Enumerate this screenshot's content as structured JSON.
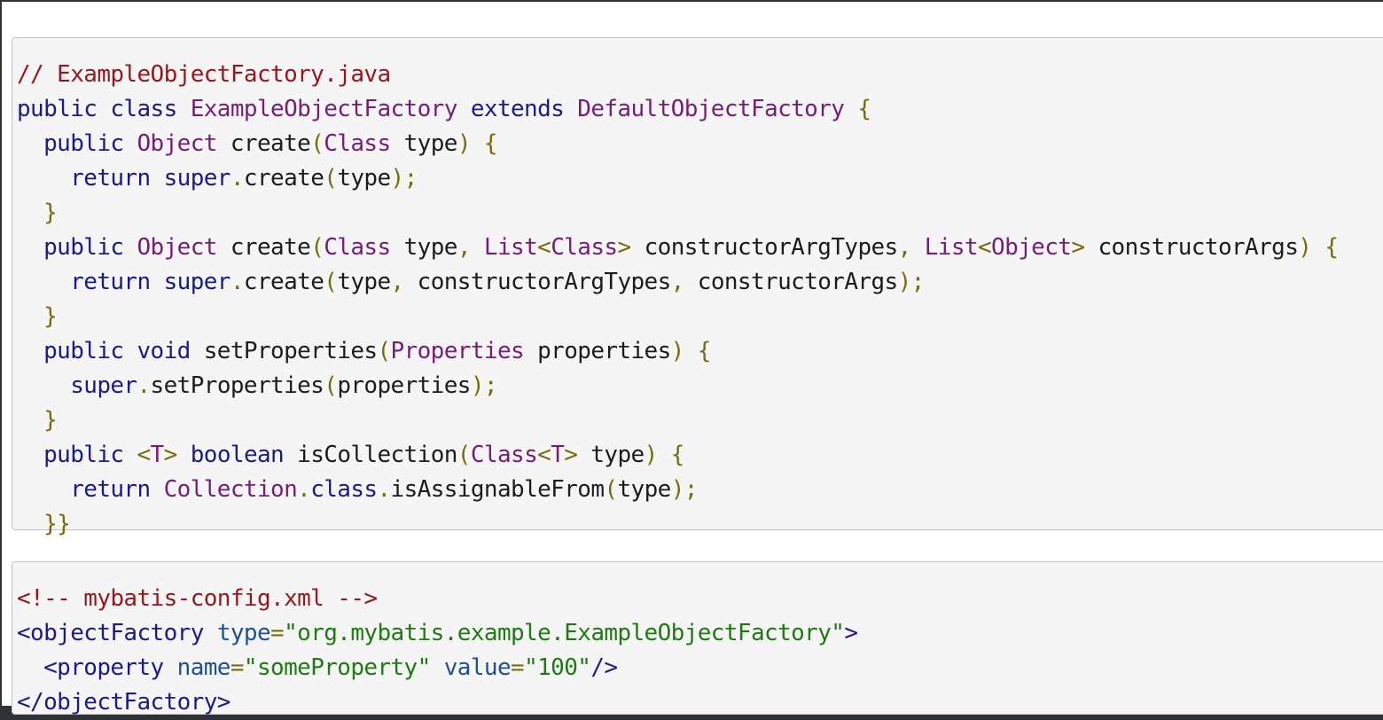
{
  "colors": {
    "comment": "#99171a",
    "keyword": "#1a1a8f",
    "type": "#771d79",
    "punct": "#7a6b0a",
    "plain": "#1c1c1c",
    "tag": "#1a1a8f",
    "attr": "#1f4f96",
    "string": "#1f7a12",
    "block_background": "#f5f5f5",
    "frame_background": "#2e3338"
  },
  "blocks": [
    {
      "language": "java",
      "lines": [
        [
          [
            "comment",
            "// ExampleObjectFactory.java"
          ]
        ],
        [
          [
            "keyword",
            "public class "
          ],
          [
            "type",
            "ExampleObjectFactory"
          ],
          [
            "keyword",
            " extends "
          ],
          [
            "type",
            "DefaultObjectFactory"
          ],
          [
            "punct",
            " {"
          ]
        ],
        [
          [
            "keyword",
            "  public "
          ],
          [
            "type",
            "Object"
          ],
          [
            "plain",
            " create"
          ],
          [
            "punct",
            "("
          ],
          [
            "type",
            "Class"
          ],
          [
            "plain",
            " type"
          ],
          [
            "punct",
            ") {"
          ]
        ],
        [
          [
            "keyword",
            "    return super"
          ],
          [
            "punct",
            "."
          ],
          [
            "plain",
            "create"
          ],
          [
            "punct",
            "("
          ],
          [
            "plain",
            "type"
          ],
          [
            "punct",
            ");"
          ]
        ],
        [
          [
            "punct",
            "  }"
          ]
        ],
        [
          [
            "keyword",
            "  public "
          ],
          [
            "type",
            "Object"
          ],
          [
            "plain",
            " create"
          ],
          [
            "punct",
            "("
          ],
          [
            "type",
            "Class"
          ],
          [
            "plain",
            " type"
          ],
          [
            "punct",
            ", "
          ],
          [
            "type",
            "List"
          ],
          [
            "punct",
            "<"
          ],
          [
            "type",
            "Class"
          ],
          [
            "punct",
            ">"
          ],
          [
            "plain",
            " constructorArgTypes"
          ],
          [
            "punct",
            ", "
          ],
          [
            "type",
            "List"
          ],
          [
            "punct",
            "<"
          ],
          [
            "type",
            "Object"
          ],
          [
            "punct",
            ">"
          ],
          [
            "plain",
            " constructorArgs"
          ],
          [
            "punct",
            ") {"
          ]
        ],
        [
          [
            "keyword",
            "    return super"
          ],
          [
            "punct",
            "."
          ],
          [
            "plain",
            "create"
          ],
          [
            "punct",
            "("
          ],
          [
            "plain",
            "type"
          ],
          [
            "punct",
            ", "
          ],
          [
            "plain",
            "constructorArgTypes"
          ],
          [
            "punct",
            ", "
          ],
          [
            "plain",
            "constructorArgs"
          ],
          [
            "punct",
            ");"
          ]
        ],
        [
          [
            "punct",
            "  }"
          ]
        ],
        [
          [
            "keyword",
            "  public void "
          ],
          [
            "plain",
            "setProperties"
          ],
          [
            "punct",
            "("
          ],
          [
            "type",
            "Properties"
          ],
          [
            "plain",
            " properties"
          ],
          [
            "punct",
            ") {"
          ]
        ],
        [
          [
            "keyword",
            "    super"
          ],
          [
            "punct",
            "."
          ],
          [
            "plain",
            "setProperties"
          ],
          [
            "punct",
            "("
          ],
          [
            "plain",
            "properties"
          ],
          [
            "punct",
            ");"
          ]
        ],
        [
          [
            "punct",
            "  }"
          ]
        ],
        [
          [
            "keyword",
            "  public "
          ],
          [
            "punct",
            "<"
          ],
          [
            "type",
            "T"
          ],
          [
            "punct",
            ">"
          ],
          [
            "keyword",
            " boolean "
          ],
          [
            "plain",
            "isCollection"
          ],
          [
            "punct",
            "("
          ],
          [
            "type",
            "Class"
          ],
          [
            "punct",
            "<"
          ],
          [
            "type",
            "T"
          ],
          [
            "punct",
            ">"
          ],
          [
            "plain",
            " type"
          ],
          [
            "punct",
            ") {"
          ]
        ],
        [
          [
            "keyword",
            "    return "
          ],
          [
            "type",
            "Collection"
          ],
          [
            "punct",
            "."
          ],
          [
            "keyword",
            "class"
          ],
          [
            "punct",
            "."
          ],
          [
            "plain",
            "isAssignableFrom"
          ],
          [
            "punct",
            "("
          ],
          [
            "plain",
            "type"
          ],
          [
            "punct",
            ");"
          ]
        ],
        [
          [
            "punct",
            "  }}"
          ]
        ]
      ]
    },
    {
      "language": "xml",
      "lines": [
        [
          [
            "comment",
            "<!-- mybatis-config.xml -->"
          ]
        ],
        [
          [
            "tag",
            "<objectFactory "
          ],
          [
            "attr",
            "type"
          ],
          [
            "punct",
            "="
          ],
          [
            "string",
            "\"org.mybatis.example.ExampleObjectFactory\""
          ],
          [
            "tag",
            ">"
          ]
        ],
        [
          [
            "tag",
            "  <property "
          ],
          [
            "attr",
            "name"
          ],
          [
            "punct",
            "="
          ],
          [
            "string",
            "\"someProperty\""
          ],
          [
            "attr",
            " value"
          ],
          [
            "punct",
            "="
          ],
          [
            "string",
            "\"100\""
          ],
          [
            "tag",
            "/>"
          ]
        ],
        [
          [
            "tag",
            "</objectFactory>"
          ]
        ]
      ]
    }
  ]
}
